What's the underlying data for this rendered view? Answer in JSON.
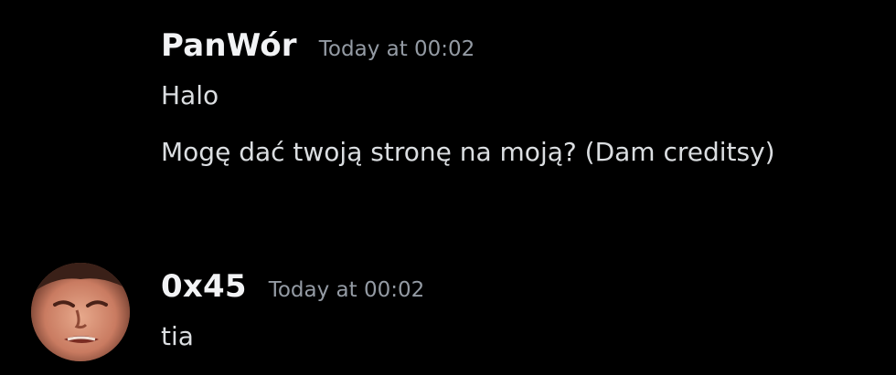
{
  "messages": [
    {
      "author": "PanWór",
      "timestamp": "Today at 00:02",
      "lines": [
        "Halo",
        "Mogę dać twoją stronę na moją? (Dam creditsy)"
      ]
    },
    {
      "author": "0x45",
      "timestamp": "Today at 00:02",
      "lines": [
        "tia"
      ],
      "avatar_icon": "face-photo-avatar"
    }
  ],
  "colors": {
    "background": "#000000",
    "username": "#f2f3f5",
    "timestamp": "#949ba4",
    "message_text": "#dbdee1"
  }
}
